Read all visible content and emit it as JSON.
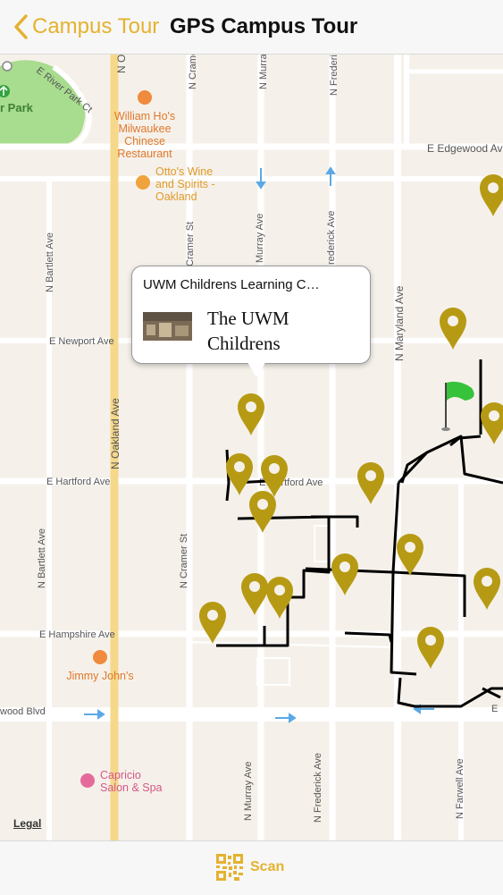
{
  "navbar": {
    "back_label": "Campus Tour",
    "title": "GPS Campus Tour"
  },
  "map": {
    "streets": {
      "n_oakland": "N Oakland Ave",
      "n_cramer_top": "N Cramer",
      "n_cramer_mid": "Cramer St",
      "n_cramer_bottom": "N Cramer St",
      "n_murray_top": "N Murray",
      "n_murray_mid": "Murray Ave",
      "n_murray_bottom": "N Murray Ave",
      "n_frederick_top": "N Frederic",
      "n_frederick_mid": "rederick Ave",
      "n_frederick_bottom": "N Frederick Ave",
      "n_maryland": "N Maryland Ave",
      "n_bartlett_top": "N Bartlett Ave",
      "n_bartlett_bottom": "N Bartlett Ave",
      "n_farwell": "N Farwell Ave",
      "n_o_top": "N O",
      "e_river_park": "E River Park Ct",
      "e_edgewood": "E Edgewood Ave",
      "e_newport": "E Newport Ave",
      "e_hartford_left": "E Hartford Ave",
      "e_hartford_right": "E Hartford Ave",
      "e_hampshire": "E Hampshire Ave",
      "wood_blvd": "wood Blvd",
      "e_right": "E"
    },
    "pois": {
      "park": "r Park",
      "william_ho": "William Ho's Milwaukee Chinese Restaurant",
      "otto": "Otto's Wine and Spirits - Oakland",
      "jimmy": "Jimmy John's",
      "capricio": "Capricio Salon & Spa"
    },
    "legal": "Legal"
  },
  "callout": {
    "title": "UWM Childrens Learning C…",
    "subtitle": "The UWM Childrens"
  },
  "toolbar": {
    "scan_label": "Scan"
  },
  "colors": {
    "accent": "#e5b22f",
    "pin": "#b79a14",
    "map_bg": "#f5f1ea",
    "road": "#ffffff",
    "oakland_road": "#f6d88a",
    "park": "#a8dc8e",
    "route": "#000000",
    "flag": "#36c23a"
  },
  "icons": {
    "back": "chevron-left-icon",
    "scan": "qr-code-icon",
    "pin": "map-pin-icon",
    "flag": "green-flag-icon"
  }
}
